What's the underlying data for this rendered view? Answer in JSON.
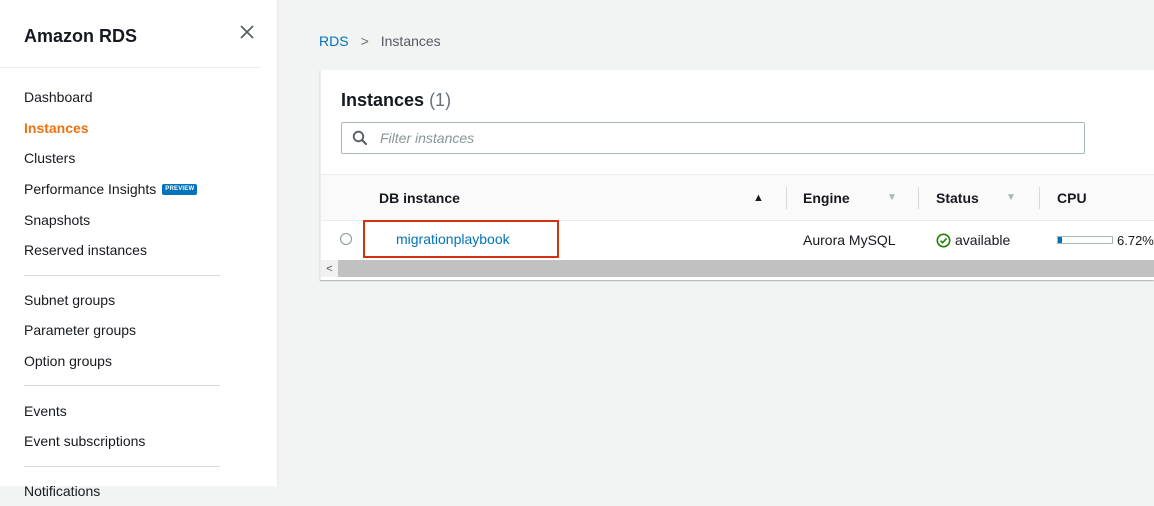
{
  "sidebar": {
    "title": "Amazon RDS",
    "groups": [
      [
        {
          "label": "Dashboard"
        },
        {
          "label": "Instances",
          "active": true
        },
        {
          "label": "Clusters"
        },
        {
          "label": "Performance Insights",
          "badge": "PREVIEW"
        },
        {
          "label": "Snapshots"
        },
        {
          "label": "Reserved instances"
        }
      ],
      [
        {
          "label": "Subnet groups"
        },
        {
          "label": "Parameter groups"
        },
        {
          "label": "Option groups"
        }
      ],
      [
        {
          "label": "Events"
        },
        {
          "label": "Event subscriptions"
        }
      ],
      [
        {
          "label": "Notifications"
        }
      ]
    ]
  },
  "breadcrumb": {
    "root": "RDS",
    "separator": ">",
    "current": "Instances"
  },
  "panel": {
    "title": "Instances",
    "count": "(1)",
    "filter_placeholder": "Filter instances"
  },
  "table": {
    "columns": [
      {
        "label": "DB instance",
        "sort": "▲"
      },
      {
        "label": "Engine",
        "sort": "▼"
      },
      {
        "label": "Status",
        "sort": "▼"
      },
      {
        "label": "CPU"
      }
    ],
    "rows": [
      {
        "db_instance": "migrationplaybook",
        "engine": "Aurora MySQL",
        "status": "available",
        "cpu_text": "6.72%",
        "cpu_fraction": 0.0672
      }
    ]
  },
  "scrollbar": {
    "left_arrow": "<"
  },
  "colors": {
    "accent": "#ec7211",
    "link": "#0073bb",
    "status_ok": "#1d8102",
    "highlight_box": "#d13212"
  }
}
